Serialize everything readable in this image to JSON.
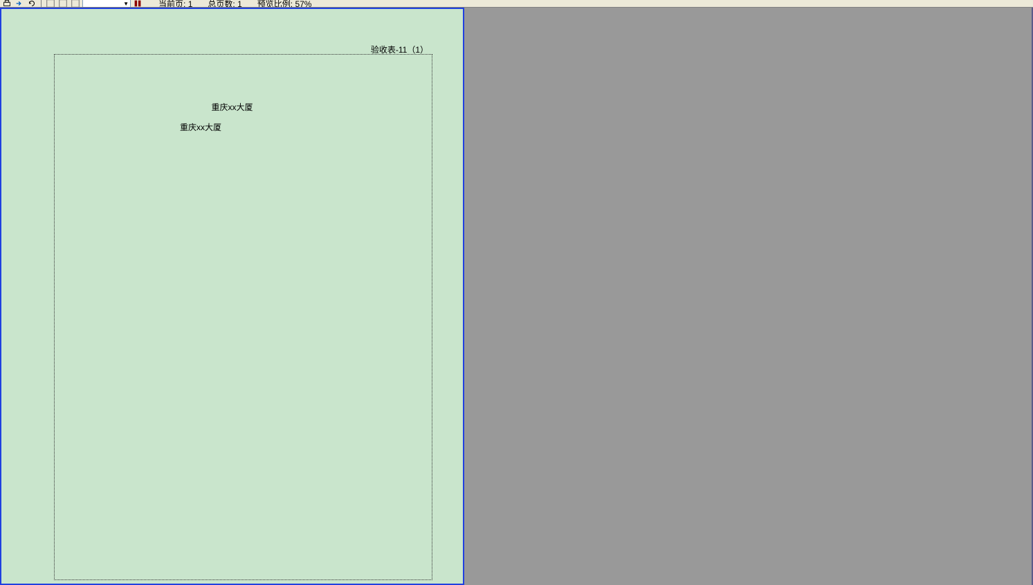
{
  "toolbar": {
    "zoom_value": "",
    "current_page_label": "当前页:",
    "current_page_value": "1",
    "total_pages_label": "总页数:",
    "total_pages_value": "1",
    "preview_ratio_label": "预览比例:",
    "preview_ratio_value": "57%"
  },
  "preview": {
    "header_label": "验收表-11（1）",
    "title_line_1": "重庆xx大厦",
    "title_line_2": "重庆xx大厦"
  }
}
